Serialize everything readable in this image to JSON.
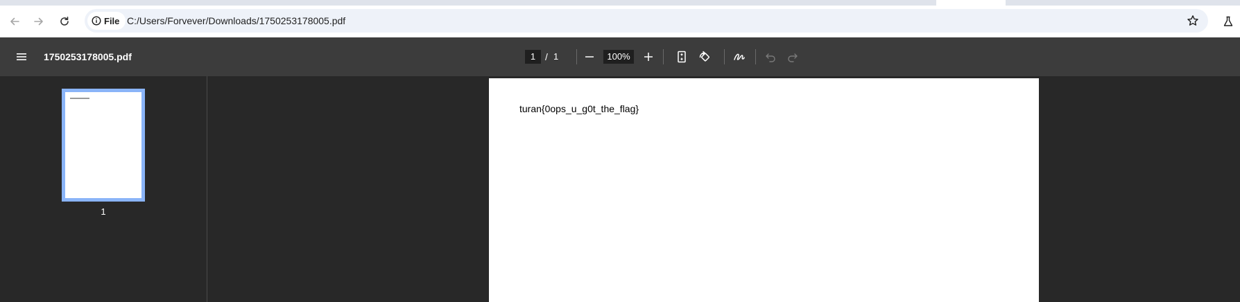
{
  "browser": {
    "address_chip": "File",
    "url": "C:/Users/Forvever/Downloads/1750253178005.pdf"
  },
  "pdf_toolbar": {
    "title": "1750253178005.pdf",
    "current_page": "1",
    "page_separator": "/",
    "total_pages": "1",
    "zoom": "100%"
  },
  "sidebar": {
    "thumbnails": [
      {
        "label": "1"
      }
    ]
  },
  "document": {
    "text": "turan{0ops_u_g0t_the_flag}"
  },
  "colors": {
    "toolbar_bg": "#3c3c3c",
    "viewer_bg": "#282828",
    "thumb_selected": "#8ab4f8",
    "omnibox_bg": "#eef2f9"
  },
  "icons": [
    "back-arrow-icon",
    "forward-arrow-icon",
    "reload-icon",
    "info-icon",
    "star-icon",
    "labs-flask-icon",
    "menu-icon",
    "zoom-out-icon",
    "zoom-in-icon",
    "fit-page-icon",
    "rotate-icon",
    "annotate-icon",
    "undo-icon",
    "redo-icon"
  ]
}
